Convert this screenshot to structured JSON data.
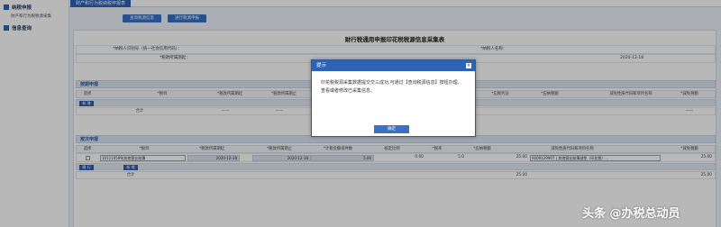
{
  "sidebar": {
    "groups": [
      {
        "label": "纳税申报",
        "items": [
          "财产和行为税税源采集"
        ]
      },
      {
        "label": "信息查询",
        "items": []
      }
    ]
  },
  "topbar": {
    "active_tab": "财产和行为税纳税申报表"
  },
  "toolbar": {
    "query_button": "查询税源信息",
    "next_button": "进行税源申报"
  },
  "document": {
    "title": "财行税通用申报印花税税源信息采集表",
    "taxpayer_id_label": "*纳税人识别号（统一社会信用代码）：",
    "taxpayer_name_label": "*纳税人名称：",
    "period_start_label": "*税款所属期起：",
    "period_end_value": "2020-12-18"
  },
  "periodic_section": {
    "title": "按期申报",
    "headers": [
      "选择",
      "*税目",
      "*税款所属期起",
      "*税款所属期止",
      "*应税凭证",
      "*应纳税额",
      "减免性质代码和项目名称",
      "*减免税额"
    ],
    "actions_button": "新 增",
    "total_label": "合计",
    "total_values": [
      "——",
      "——",
      "——"
    ]
  },
  "times_section": {
    "title": "按次申报",
    "headers": [
      "选择",
      "*税目",
      "*税款所属期起",
      "*税款所属期止",
      "*计税金额或件数",
      "核定比例",
      "*税率",
      "*应纳税额",
      "减免性质代码和项目名称",
      "*减免税额"
    ],
    "row": {
      "tax_item": "101110599|其他营业账簿",
      "period_start": "2020-12-18",
      "period_end": "2020-12-18",
      "amount": "5.00",
      "ratio": "0.00",
      "rate": "5.0",
      "tax_due": "25.00",
      "exemption": "0009129907 | 其他营业账簿减免（印花税）...",
      "exempt_amount": "25.00"
    },
    "delete_button": "删 行",
    "add_button": "新 增",
    "total_label": "合计",
    "total_tax": "25.00",
    "total_exempt": "25.00"
  },
  "dialog": {
    "title": "提示",
    "close_glyph": "×",
    "message": "印花税税源采集数据提交交三成功,可通过【查询税源信息】按钮办理、查看或者修改已采集信息。",
    "ok_label": "确定"
  },
  "watermark": "头条 @办税总动员"
}
